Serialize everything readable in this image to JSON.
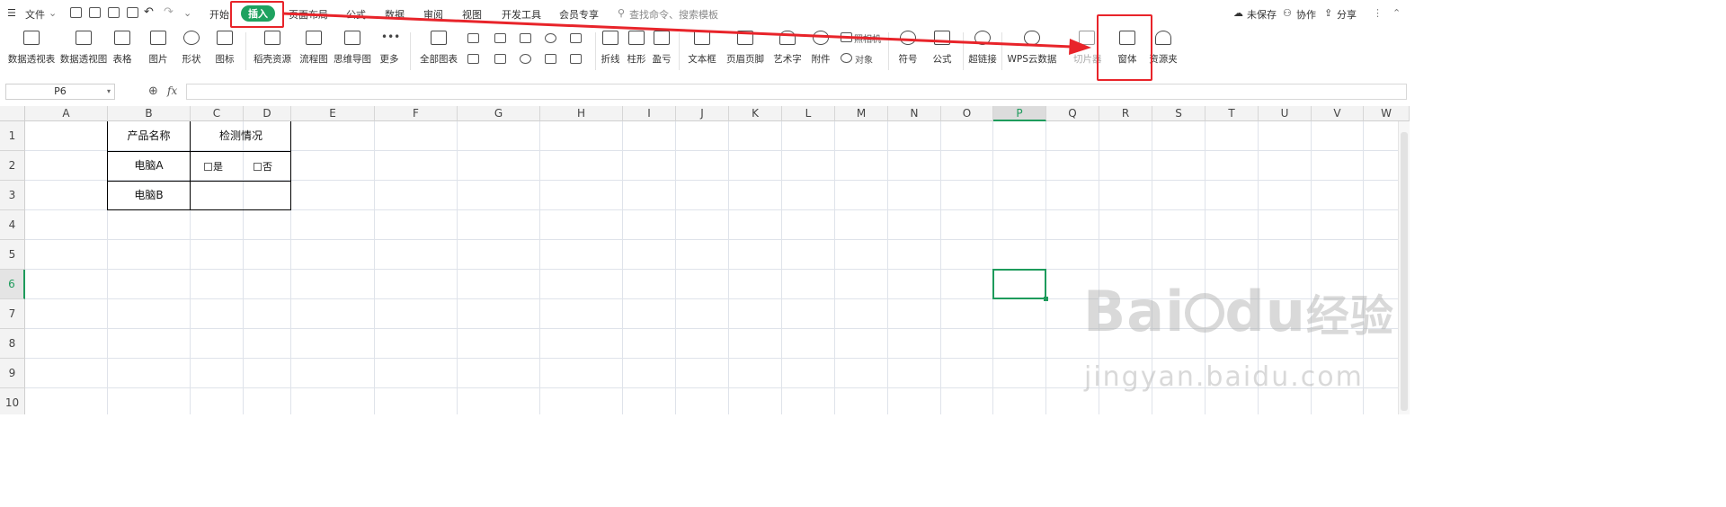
{
  "menu": {
    "file": "文件",
    "tabs": [
      "开始",
      "插入",
      "页面布局",
      "公式",
      "数据",
      "审阅",
      "视图",
      "开发工具",
      "会员专享"
    ],
    "active_tab": "插入",
    "search_placeholder": "查找命令、搜索模板",
    "right": {
      "unsaved": "未保存",
      "collab": "协作",
      "share": "分享"
    }
  },
  "ribbon": {
    "pivot_table": "数据透视表",
    "pivot_chart": "数据透视图",
    "table": "表格",
    "picture": "图片",
    "shape": "形状",
    "icon": "图标",
    "docer": "稻壳资源",
    "flowchart": "流程图",
    "mindmap": "思维导图",
    "more": "更多",
    "all_charts": "全部图表",
    "line": "折线",
    "column": "柱形",
    "winloss": "盈亏",
    "textbox": "文本框",
    "header_footer": "页眉页脚",
    "wordart": "艺术字",
    "attachment": "附件",
    "camera": "照相机",
    "object": "对象",
    "symbol": "符号",
    "formula": "公式",
    "hyperlink": "超链接",
    "wps_cloud": "WPS云数据",
    "slicer": "切片器",
    "form": "窗体",
    "resources": "资源夹"
  },
  "formula_bar": {
    "name_box": "P6",
    "fx": "fx",
    "value": ""
  },
  "sheet": {
    "columns": [
      "A",
      "B",
      "C",
      "D",
      "E",
      "F",
      "G",
      "H",
      "I",
      "J",
      "K",
      "L",
      "M",
      "N",
      "O",
      "P",
      "Q",
      "R",
      "S",
      "T",
      "U",
      "V",
      "W"
    ],
    "rows": [
      "1",
      "2",
      "3",
      "4",
      "5",
      "6",
      "7",
      "8",
      "9",
      "10"
    ],
    "selected_cell": "P6",
    "table": {
      "header_product": "产品名称",
      "header_status": "检测情况",
      "row1_product": "电脑A",
      "row1_yes": "是",
      "row1_no": "否",
      "row2_product": "电脑B"
    }
  },
  "watermark": {
    "brand": "Bai",
    "brand2": "du",
    "cn": "经验",
    "url": "jingyan.baidu.com"
  },
  "colors": {
    "accent_green": "#1ea25f",
    "highlight_red": "#e8242a"
  }
}
